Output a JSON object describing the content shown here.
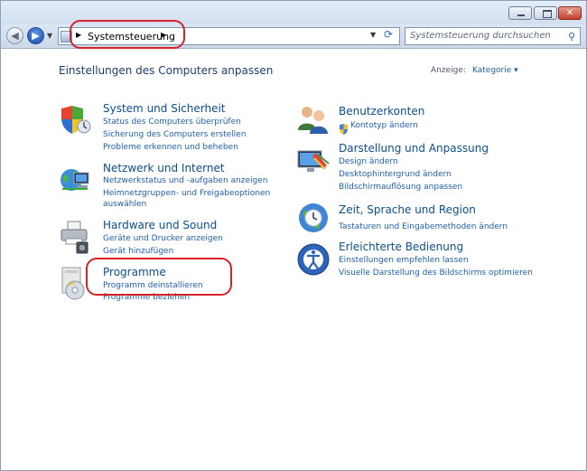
{
  "window": {
    "controls": {
      "minimize": "minimize",
      "maximize": "maximize",
      "close": "close"
    },
    "close_glyph": "✕"
  },
  "navigation": {
    "back_glyph": "◀",
    "forward_glyph": "▶",
    "address_path": "Systemsteuerung",
    "search_placeholder": "Systemsteuerung durchsuchen"
  },
  "header": {
    "title": "Einstellungen des Computers anpassen",
    "view_label": "Anzeige:",
    "view_value": "Kategorie ▾"
  },
  "categories_left": [
    {
      "title": "System und Sicherheit",
      "icon": "shield-icon",
      "links": [
        "Status des Computers überprüfen",
        "Sicherung des Computers erstellen",
        "Probleme erkennen und beheben"
      ]
    },
    {
      "title": "Netzwerk und Internet",
      "icon": "network-globe-icon",
      "links": [
        "Netzwerkstatus und -aufgaben anzeigen",
        "Heimnetzgruppen- und Freigabeoptionen",
        "auswählen"
      ]
    },
    {
      "title": "Hardware und Sound",
      "icon": "printer-speaker-icon",
      "links": [
        "Geräte und Drucker anzeigen",
        "Gerät hinzufügen"
      ]
    },
    {
      "title": "Programme",
      "icon": "programs-disc-icon",
      "links": [
        "Programm deinstallieren",
        "Programme beziehen"
      ]
    }
  ],
  "categories_right": [
    {
      "title": "Benutzerkonten",
      "icon": "users-icon",
      "links": [
        "Kontotyp ändern"
      ]
    },
    {
      "title": "Darstellung und Anpassung",
      "icon": "display-appearance-icon",
      "links": [
        "Design ändern",
        "Desktophintergrund ändern",
        "Bildschirmauflösung anpassen"
      ]
    },
    {
      "title": "Zeit, Sprache und Region",
      "icon": "clock-globe-icon",
      "links": [
        "Tastaturen und Eingabemethoden ändern"
      ]
    },
    {
      "title": "Erleichterte Bedienung",
      "icon": "accessibility-icon",
      "links": [
        "Einstellungen empfehlen lassen",
        "Visuelle Darstellung des Bildschirms optimieren"
      ]
    }
  ],
  "colors": {
    "highlight_ring": "#d82229",
    "category_title": "#0b4f8c",
    "link": "#1e5fad"
  }
}
